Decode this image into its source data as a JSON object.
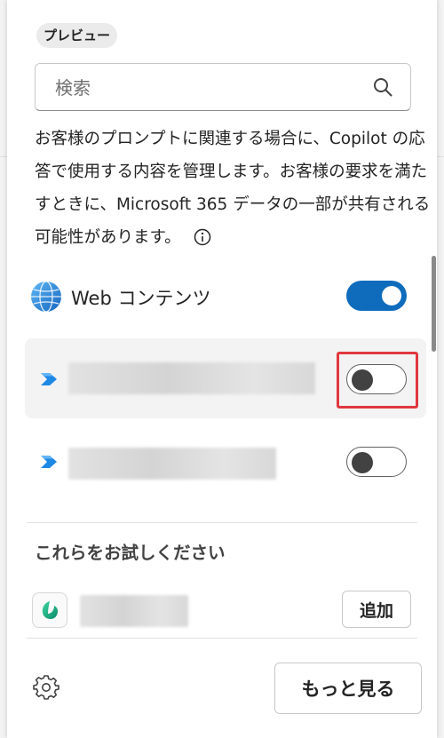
{
  "panel": {
    "badge": "プレビュー",
    "search": {
      "placeholder": "検索",
      "value": ""
    },
    "description": "お客様のプロンプトに関連する場合に、Copilot の応答で使用する内容を管理します。お客様の要求を満たすときに、Microsoft 365 データの一部が共有される可能性があります。",
    "info_icon": "info-icon"
  },
  "sources": [
    {
      "label": "Web コンテンツ",
      "icon": "globe-icon",
      "enabled": true
    },
    {
      "label": "",
      "icon": "connector-icon",
      "enabled": false,
      "highlighted": true
    },
    {
      "label": "",
      "icon": "connector-icon",
      "enabled": false
    }
  ],
  "suggestions": {
    "title": "これらをお試しください",
    "items": [
      {
        "label": "",
        "icon": "agent-icon",
        "button": "追加"
      }
    ]
  },
  "footer": {
    "settings_icon": "gear-icon",
    "more_button": "もっと見る"
  },
  "colors": {
    "accent": "#0f6cbd",
    "highlight_border": "#e0383e",
    "panel": "#ffffff"
  }
}
